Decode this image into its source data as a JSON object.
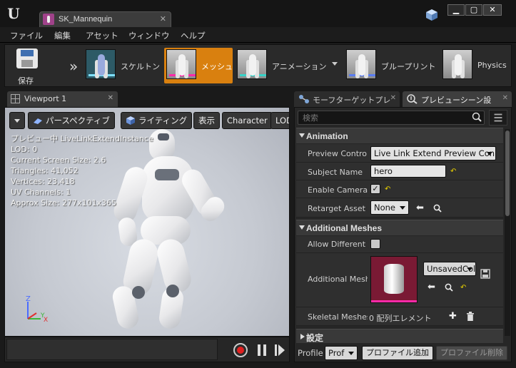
{
  "window": {
    "asset_tab": "SK_Mannequin",
    "minimize": "▁",
    "maximize": "▢",
    "close": "✕",
    "tab_close": "✕"
  },
  "menu": [
    "ファイル",
    "編集",
    "アセット",
    "ウィンドウ",
    "ヘルプ"
  ],
  "modebar": {
    "save_label": "保存",
    "modes": [
      {
        "label": "スケルトン"
      },
      {
        "label": "メッシュ"
      },
      {
        "label": "アニメーション"
      },
      {
        "label": "ブループリント"
      },
      {
        "label": "Physics"
      }
    ],
    "active_mode": "メッシュ"
  },
  "viewport": {
    "tab_label": "Viewport 1",
    "tab_close": "✕",
    "toolbar": {
      "perspective": "パースペクティブ",
      "lighting": "ライティング",
      "show": "表示",
      "character": "Character",
      "lod": "LOD"
    },
    "stats": [
      "プレビュー中 LiveLinkExtendInstance",
      "LOD: 0",
      "Current Screen Size: 2.6",
      "Triangles: 41,052",
      "Vertices: 23,418",
      "UV Channels: 1",
      "Approx Size: 277x101x365"
    ],
    "axis": {
      "z": "Z",
      "y": "Y",
      "x": "X"
    }
  },
  "rightpanel": {
    "tabs": [
      {
        "label": "モーフターゲットプレ"
      },
      {
        "label": "プレビューシーン設"
      }
    ],
    "tab_close": "✕",
    "search_placeholder": "検索",
    "categories": {
      "animation": "Animation",
      "additional_meshes": "Additional Meshes",
      "settings": "設定"
    },
    "animation": {
      "preview_controller_label": "Preview Controll",
      "preview_controller_value": "Live Link Extend Preview Con",
      "subject_name_label": "Subject Name",
      "subject_name_value": "hero",
      "enable_camera_label": "Enable Camera S",
      "enable_camera_checked": true,
      "retarget_asset_label": "Retarget Asset",
      "retarget_asset_value": "None"
    },
    "additional": {
      "allow_different_label": "Allow Different S",
      "allow_different_checked": false,
      "additional_mesh_label": "Additional Mesh",
      "additional_mesh_value": "UnsavedCol",
      "skeletal_meshes_label": "Skeletal Meshes",
      "skeletal_meshes_value": "0 配列エレメント"
    },
    "glyphs": {
      "reset": "↶",
      "arrow_left": "⬅",
      "check": "✓",
      "plus": "✚",
      "trash": "🗑"
    },
    "footer": {
      "profile_label": "Profile",
      "profile_value": "Prof",
      "add_profile": "プロファイル追加",
      "remove_profile": "プロファイル削除"
    }
  },
  "colors": {
    "accent": "#d9800f",
    "mesh_bar": "#ff2aa8",
    "record": "#e02020"
  }
}
